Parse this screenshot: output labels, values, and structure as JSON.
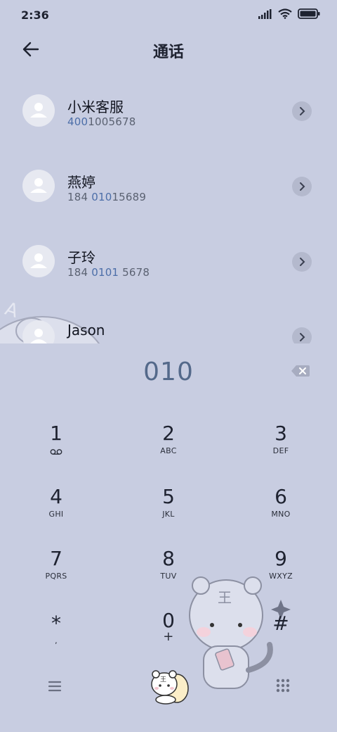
{
  "status": {
    "time": "2:36"
  },
  "header": {
    "title": "通话"
  },
  "contacts": [
    {
      "name": "小米客服",
      "number_parts": [
        "400",
        "1005678"
      ],
      "hl": [
        false,
        false
      ],
      "number_full": "4001005678"
    },
    {
      "name": "燕婷",
      "number_parts": [
        "184 ",
        "010",
        "15689"
      ],
      "number_full": "184 01015689"
    },
    {
      "name": "子玲",
      "number_parts": [
        "184 ",
        "0101",
        " 5678"
      ],
      "number_full": "184 0101 5678"
    },
    {
      "name": "Jason"
    }
  ],
  "dial": {
    "value": "010"
  },
  "keypad": [
    {
      "digit": "1",
      "letters": ""
    },
    {
      "digit": "2",
      "letters": "ABC"
    },
    {
      "digit": "3",
      "letters": "DEF"
    },
    {
      "digit": "4",
      "letters": "GHI"
    },
    {
      "digit": "5",
      "letters": "JKL"
    },
    {
      "digit": "6",
      "letters": "MNO"
    },
    {
      "digit": "7",
      "letters": "PQRS"
    },
    {
      "digit": "8",
      "letters": "TUV"
    },
    {
      "digit": "9",
      "letters": "WXYZ"
    },
    {
      "digit": "*",
      "letters": ","
    },
    {
      "digit": "0",
      "letters": "+"
    },
    {
      "digit": "#",
      "letters": ""
    }
  ],
  "decor": {
    "tiger_mark": "王"
  },
  "colors": {
    "background": "#c8cde1",
    "dial_text": "#54698a",
    "highlight": "#4c6ea8"
  },
  "icons": [
    "back-arrow-icon",
    "signal-icon",
    "wifi-icon",
    "battery-icon",
    "person-icon",
    "chevron-right-icon",
    "backspace-icon",
    "voicemail-icon",
    "menu-icon",
    "dialpad-icon"
  ]
}
